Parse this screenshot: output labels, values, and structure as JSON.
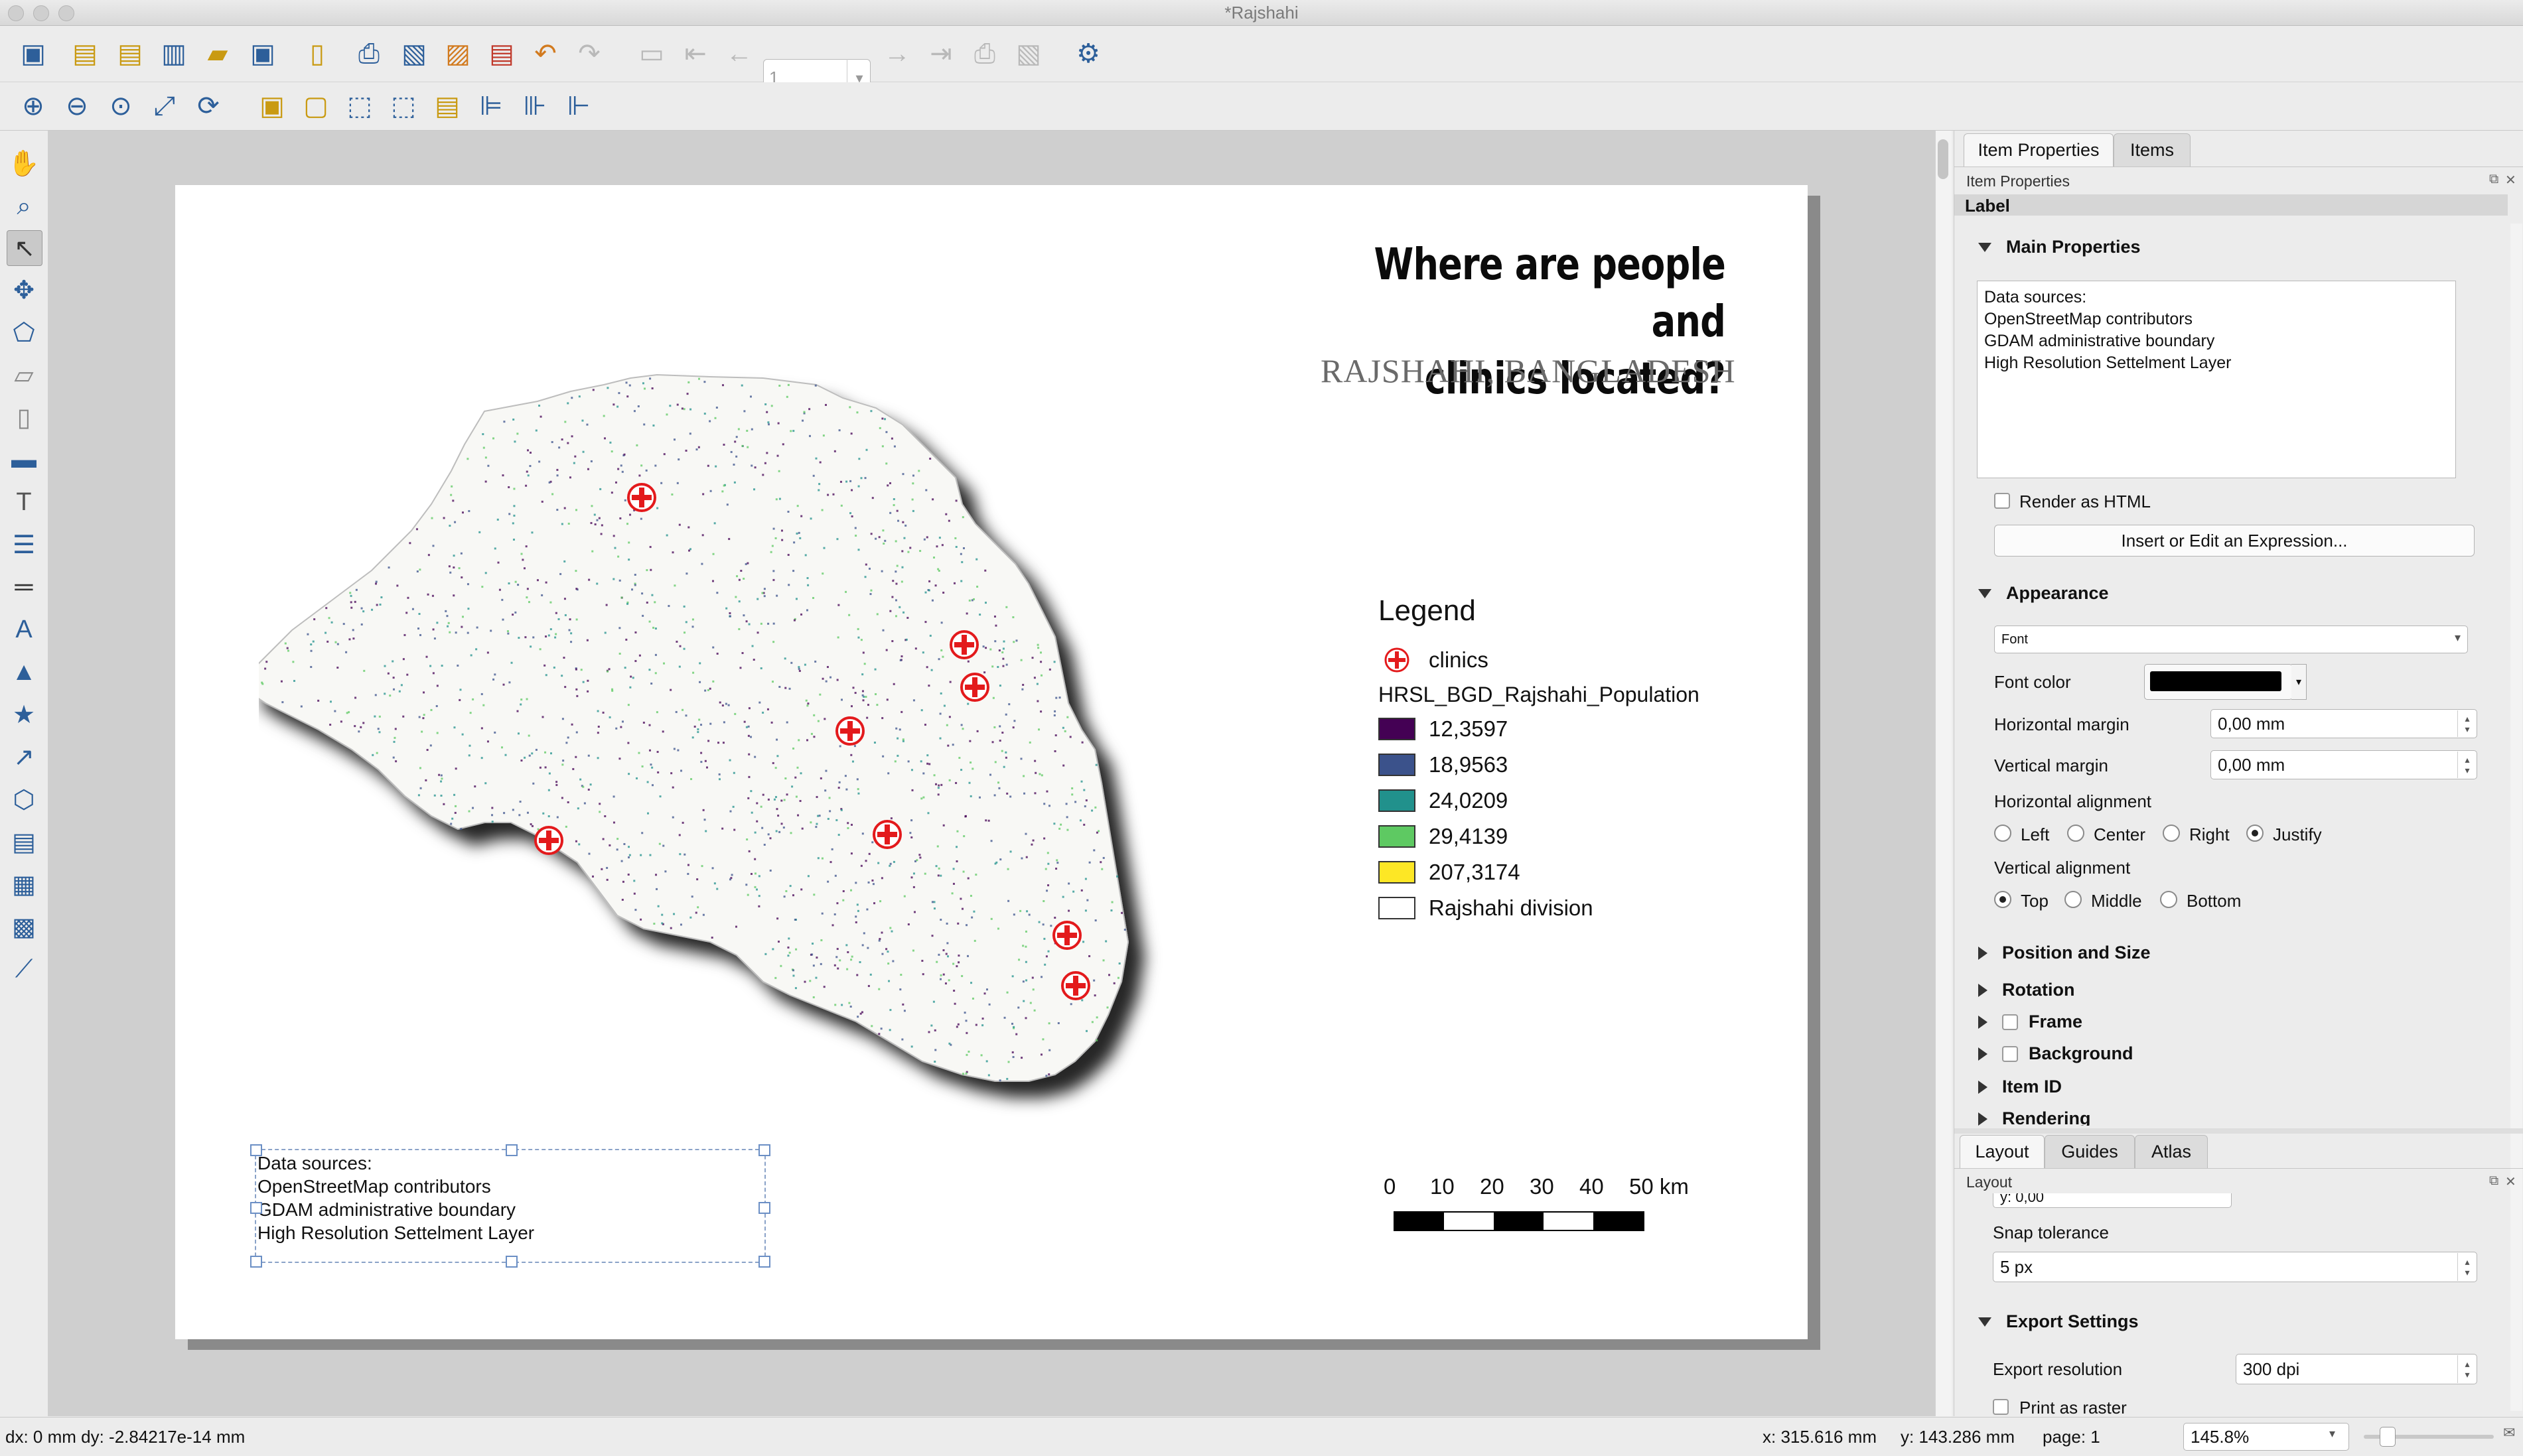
{
  "window": {
    "title": "*Rajshahi"
  },
  "toolbar": {
    "page_number": "1",
    "icons": [
      "save-icon",
      "new-layout-icon",
      "duplicate-layout-icon",
      "layout-manager-icon",
      "open-template-icon",
      "save-template-icon",
      "page-setup-icon",
      "print-icon",
      "export-image-icon",
      "export-svg-icon",
      "export-pdf-icon",
      "undo-icon",
      "redo-icon",
      "atlas-settings-icon",
      "first-feature-icon",
      "previous-feature-icon",
      "next-feature-icon",
      "last-feature-icon",
      "atlas-print-icon",
      "atlas-export-icon",
      "atlas-settings-icon-2"
    ],
    "nav_icons": [
      "zoom-in-icon",
      "zoom-out-icon",
      "zoom-actual-icon",
      "zoom-full-icon",
      "refresh-icon",
      "lock-items-icon",
      "unlock-items-icon",
      "group-icon",
      "ungroup-icon",
      "raise-icon",
      "align-icon",
      "distribute-icon",
      "resize-icon"
    ]
  },
  "left_tools": [
    "pan-icon",
    "zoom-tool-icon",
    "select-tool-icon",
    "move-content-icon",
    "edit-nodes-icon",
    "add-map-icon",
    "add-3d-map-icon",
    "add-picture-icon",
    "add-label-icon",
    "add-legend-icon",
    "add-scalebar-icon",
    "add-north-arrow-icon",
    "add-shape-icon",
    "add-marker-icon",
    "add-arrow-icon",
    "add-node-item-icon",
    "add-html-icon",
    "add-attribute-table-icon",
    "add-fixed-table-icon",
    "add-chart-icon"
  ],
  "map": {
    "title_line1": "Where are people and",
    "title_line2": "clinics located?",
    "subtitle": "RAJSHAHI, BANGLADESH",
    "legend": {
      "title": "Legend",
      "clinics_label": "clinics",
      "layer_name": "HRSL_BGD_Rajshahi_Population",
      "classes": [
        {
          "label": "12,3597",
          "color": "#440154"
        },
        {
          "label": "18,9563",
          "color": "#3b528b"
        },
        {
          "label": "24,0209",
          "color": "#21918c"
        },
        {
          "label": "29,4139",
          "color": "#5ec962"
        },
        {
          "label": "207,3174",
          "color": "#fde725"
        }
      ],
      "division_label": "Rajshahi division",
      "division_color": "#ffffff"
    },
    "scalebar": {
      "labels": [
        "0",
        "10",
        "20",
        "30",
        "40",
        "50 km"
      ]
    },
    "data_sources": {
      "line1": "Data sources:",
      "line2": "OpenStreetMap contributors",
      "line3": "GDAM administrative boundary",
      "line4": "High Resolution Settelment Layer"
    },
    "clinic_color": "#e31a1c"
  },
  "panel": {
    "tabs": [
      "Item Properties",
      "Items"
    ],
    "header": "Item Properties",
    "item_type": "Label",
    "main_properties": "Main Properties",
    "label_text": {
      "line1": "Data sources:",
      "line2": "OpenStreetMap contributors",
      "line3": "GDAM administrative boundary",
      "line4": "High Resolution Settelment Layer"
    },
    "render_html": "Render as HTML",
    "insert_expr": "Insert or Edit an Expression...",
    "appearance": "Appearance",
    "font_btn": "Font",
    "font_color": "Font color",
    "font_color_value": "#000000",
    "h_margin": "Horizontal margin",
    "h_margin_value": "0,00 mm",
    "v_margin": "Vertical margin",
    "v_margin_value": "0,00 mm",
    "h_align": "Horizontal alignment",
    "h_align_options": [
      "Left",
      "Center",
      "Right",
      "Justify"
    ],
    "v_align": "Vertical alignment",
    "v_align_options": [
      "Top",
      "Middle",
      "Bottom"
    ],
    "collapsed": [
      "Position and Size",
      "Rotation",
      "Frame",
      "Background",
      "Item ID",
      "Rendering"
    ]
  },
  "layout_panel": {
    "tabs": [
      "Layout",
      "Guides",
      "Atlas"
    ],
    "header": "Layout",
    "partial_value": "y: 0,00",
    "snap_label": "Snap tolerance",
    "snap_value": "5 px",
    "export_settings": "Export Settings",
    "export_res_label": "Export resolution",
    "export_res_value": "300 dpi",
    "print_raster": "Print as raster"
  },
  "status": {
    "delta": "dx: 0 mm dy: -2.84217e-14 mm",
    "x": "x: 315.616 mm",
    "y": "y: 143.286 mm",
    "page": "page: 1",
    "zoom": "145.8%"
  }
}
